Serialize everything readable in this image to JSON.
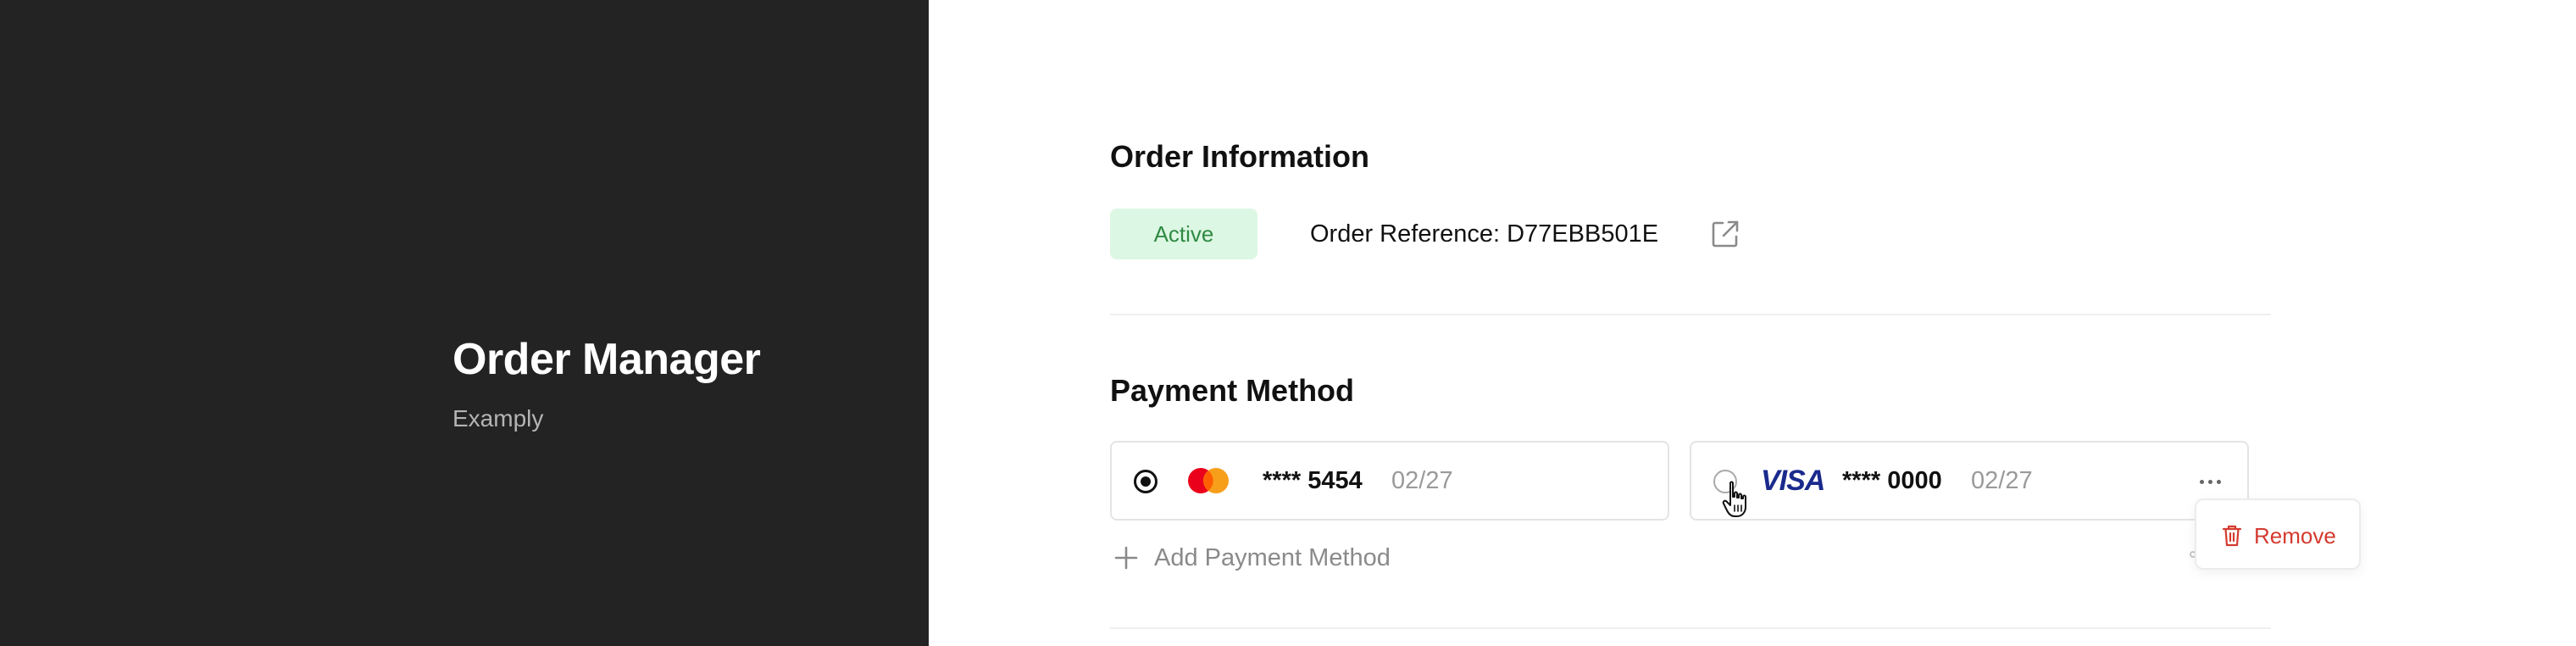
{
  "sidebar": {
    "app_title": "Order Manager",
    "app_subtitle": "Examply"
  },
  "order_info": {
    "section_title": "Order Information",
    "status": "Active",
    "reference_label": "Order Reference: D77EBB501E",
    "external_link_icon": "external-link-icon"
  },
  "payment": {
    "section_title": "Payment Method",
    "cards": [
      {
        "brand": "mastercard",
        "number": "**** 5454",
        "expiry": "02/27",
        "selected": true
      },
      {
        "brand": "VISA",
        "number": "**** 0000",
        "expiry": "02/27",
        "selected": false
      }
    ],
    "add_label": "Add Payment Method"
  },
  "card_menu": {
    "remove_label": "Remove"
  },
  "colors": {
    "sidebar_bg": "#232323",
    "status_bg": "#dcf7e3",
    "status_text": "#2f8a43",
    "danger": "#d43a2f",
    "visa_blue": "#1a2a8c",
    "mastercard_red": "#eb001b",
    "mastercard_orange": "#f79e1b"
  }
}
